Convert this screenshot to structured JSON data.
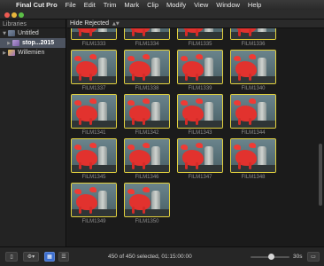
{
  "menubar": {
    "apple_icon": "apple-logo-icon",
    "items": [
      "Final Cut Pro",
      "File",
      "Edit",
      "Trim",
      "Mark",
      "Clip",
      "Modify",
      "View",
      "Window",
      "Help"
    ]
  },
  "sidebar": {
    "header": "Libraries",
    "libraries": [
      {
        "label": "Untitled",
        "icon": "library-icon",
        "level": 0,
        "expanded": true,
        "selected": false
      },
      {
        "label": "stop...2015",
        "icon": "event-star-icon",
        "level": 1,
        "expanded": false,
        "selected": true
      },
      {
        "label": "Willemien",
        "icon": "library-icon",
        "level": 0,
        "expanded": false,
        "selected": false
      }
    ]
  },
  "browser": {
    "filter": "Hide Rejected",
    "clips": [
      "FILM1333",
      "FILM1334",
      "FILM1335",
      "FILM1336",
      "FILM1337",
      "FILM1338",
      "FILM1339",
      "FILM1340",
      "FILM1341",
      "FILM1342",
      "FILM1343",
      "FILM1344",
      "FILM1345",
      "FILM1346",
      "FILM1347",
      "FILM1348",
      "FILM1349",
      "FILM1350"
    ],
    "selection_color": "#e4d23e"
  },
  "bottombar": {
    "status": "450 of 450 selected, 01:15:00:00",
    "zoom_duration": "30s",
    "zoom_level": 0.55
  },
  "colors": {
    "accent": "#3c6fd0",
    "sidebar_selected": "#4d5461",
    "close": "#ee5b52",
    "minimize": "#e7b63c",
    "zoom": "#5cbf47"
  }
}
